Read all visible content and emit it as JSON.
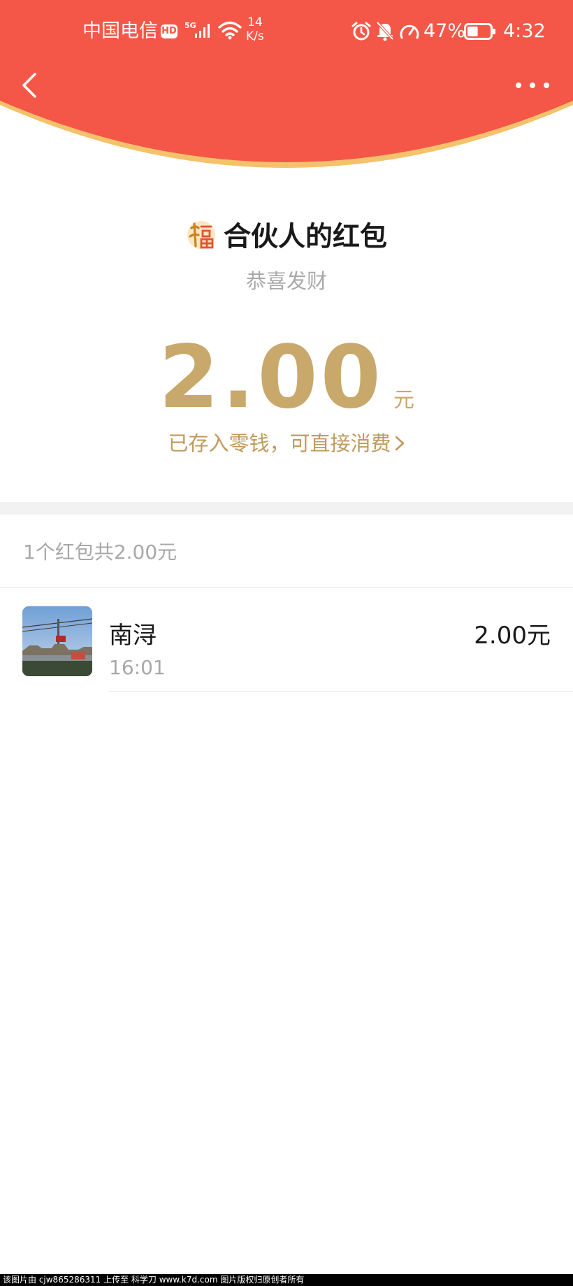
{
  "status_bar": {
    "carrier": "中国电信",
    "hd_badge": "HD",
    "network_type": "5G",
    "net_speed_value": "14",
    "net_speed_unit": "K/s",
    "battery_percent": "47%",
    "battery_level": 0.47,
    "time": "4:32"
  },
  "header": {
    "background_color": "#f45748",
    "edge_color": "#f5c36a",
    "back_icon": "chevron-left-icon",
    "more_icon": "more-dots-icon"
  },
  "red_packet": {
    "fu_icon": "fu-character-icon",
    "title": "合伙人的红包",
    "blessing": "恭喜发财",
    "amount": "2.00",
    "unit": "元",
    "wallet_link": "已存入零钱，可直接消费",
    "accent_color": "#c9a86c"
  },
  "summary": {
    "text": "1个红包共2.00元"
  },
  "receivers": [
    {
      "name": "南浔",
      "time": "16:01",
      "amount": "2.00元"
    }
  ],
  "watermark": {
    "text": "该图片由 cjw865286311 上传至 科学刀 www.k7d.com 图片版权归原创者所有"
  }
}
